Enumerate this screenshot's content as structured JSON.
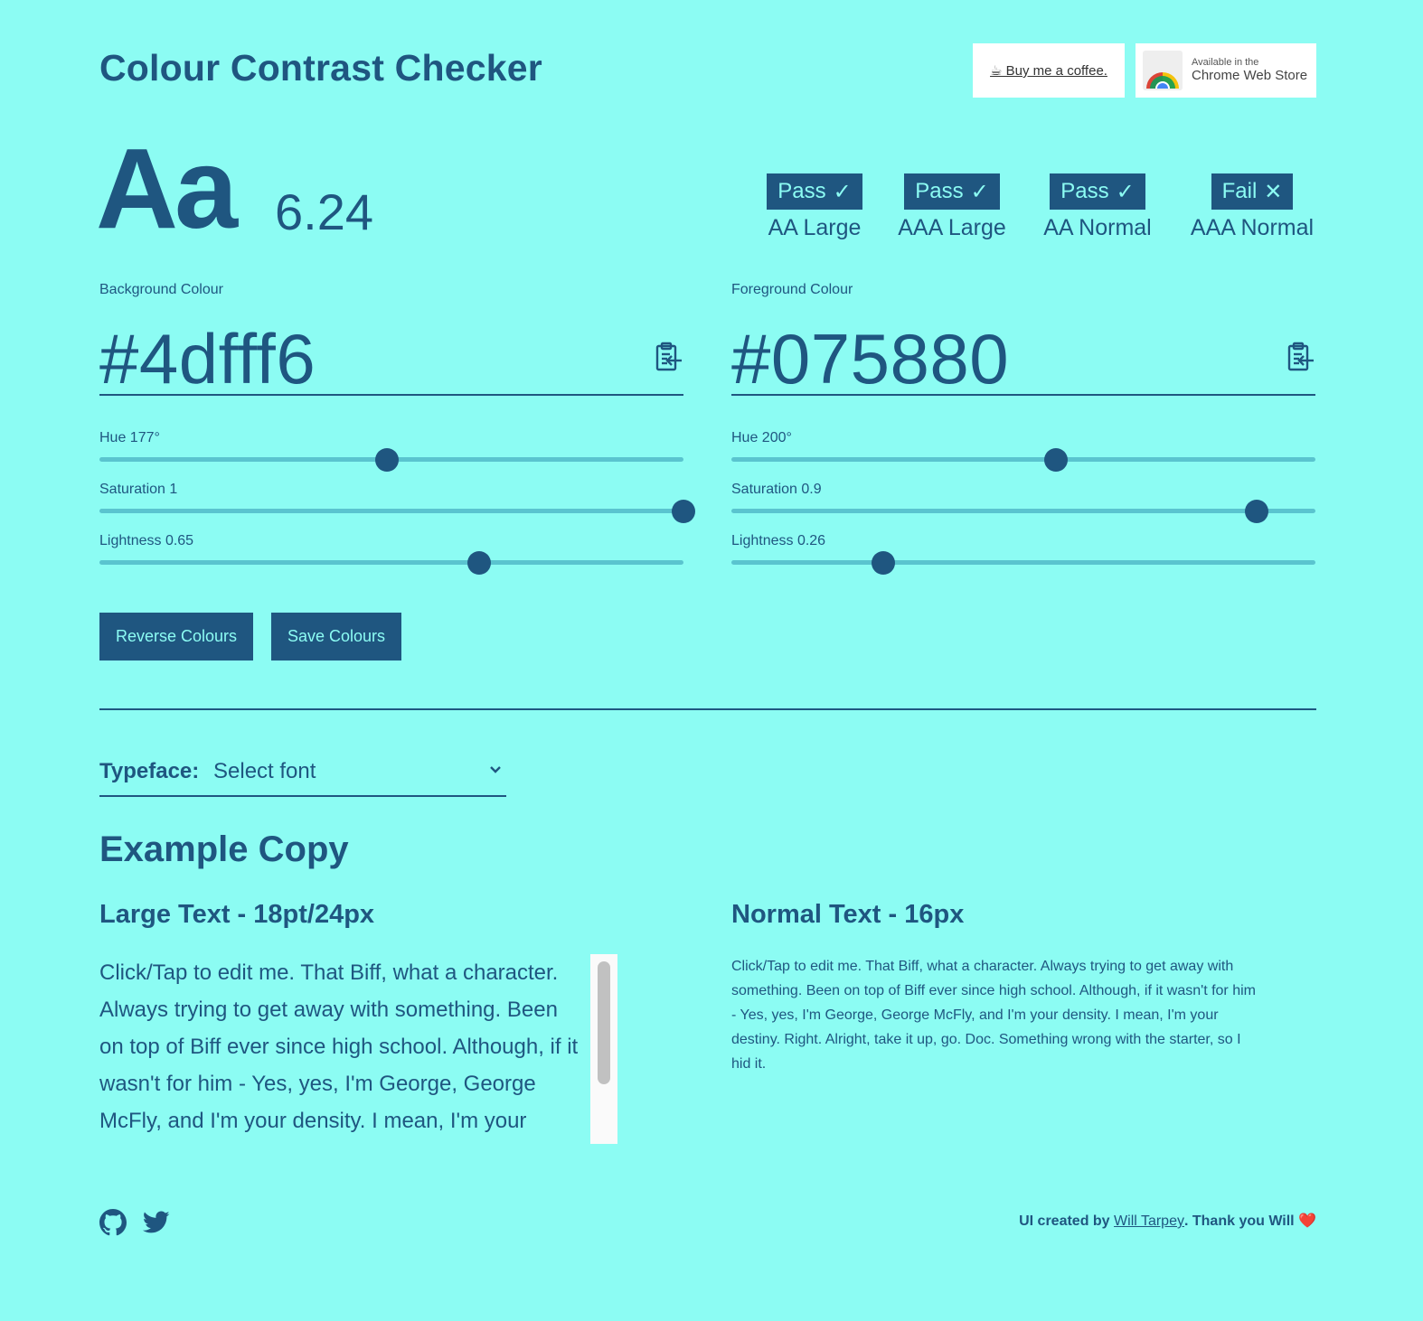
{
  "header": {
    "title": "Colour Contrast Checker",
    "coffee_label": "☕ Buy me a coffee.",
    "chrome_small": "Available in the",
    "chrome_big": "Chrome Web Store"
  },
  "preview": {
    "sample": "Aa",
    "ratio": "6.24"
  },
  "badges": [
    {
      "status": "Pass",
      "mark": "✓",
      "label": "AA Large"
    },
    {
      "status": "Pass",
      "mark": "✓",
      "label": "AAA Large"
    },
    {
      "status": "Pass",
      "mark": "✓",
      "label": "AA Normal"
    },
    {
      "status": "Fail",
      "mark": "✕",
      "label": "AAA Normal"
    }
  ],
  "background": {
    "label": "Background Colour",
    "hex": "#4dfff6",
    "hue_label": "Hue 177°",
    "hue": 177,
    "saturation_label": "Saturation 1",
    "saturation": 1,
    "lightness_label": "Lightness 0.65",
    "lightness": 0.65
  },
  "foreground": {
    "label": "Foreground Colour",
    "hex": "#075880",
    "hue_label": "Hue 200°",
    "hue": 200,
    "saturation_label": "Saturation 0.9",
    "saturation": 0.9,
    "lightness_label": "Lightness 0.26",
    "lightness": 0.26
  },
  "actions": {
    "reverse_label": "Reverse Colours",
    "save_label": "Save Colours"
  },
  "typeface": {
    "label": "Typeface:",
    "value": "Select font"
  },
  "example": {
    "heading": "Example Copy",
    "large_heading": "Large Text - 18pt/24px",
    "normal_heading": "Normal Text - 16px",
    "large_text": "Click/Tap to edit me. That Biff, what a character. Always trying to get away with something. Been on top of Biff ever since high school. Although, if it wasn't for him - Yes, yes, I'm George, George McFly, and I'm your density. I mean, I'm your destiny. Right. Alright, take it up, go. Doc. Something wrong with the starter, so I hid it.",
    "normal_text": "Click/Tap to edit me. That Biff, what a character. Always trying to get away with something. Been on top of Biff ever since high school. Although, if it wasn't for him - Yes, yes, I'm George, George McFly, and I'm your density. I mean, I'm your destiny. Right. Alright, take it up, go. Doc. Something wrong with the starter, so I hid it."
  },
  "footer": {
    "credit_prefix": "UI created by",
    "credit_link": "Will Tarpey",
    "credit_suffix": ". Thank you Will ❤️"
  },
  "colors": {
    "page_background": "#8cfcf3",
    "text": "#1f5680",
    "slider_track": "#5ac4cf"
  },
  "icons": [
    "coffee-icon",
    "chrome-logo-icon",
    "check-icon",
    "cross-icon",
    "clipboard-icon",
    "chevron-down-icon",
    "github-icon",
    "twitter-icon"
  ]
}
